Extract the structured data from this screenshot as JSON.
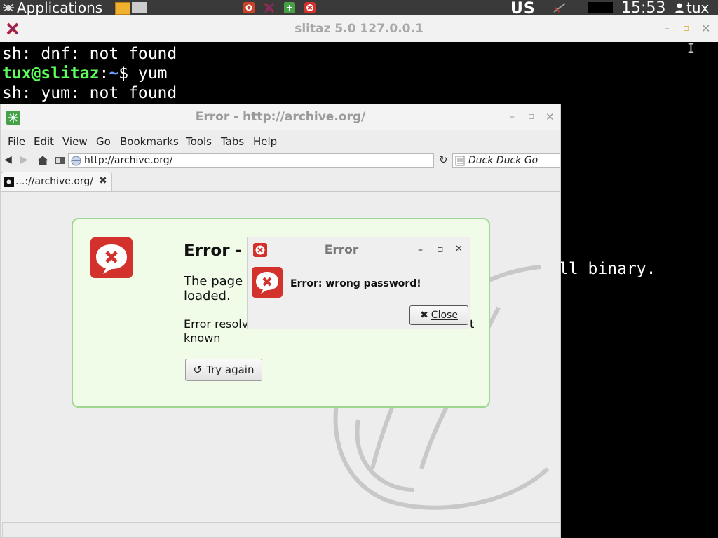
{
  "panel": {
    "applications_label": "Applications",
    "keyboard_layout": "US",
    "clock": "15:53",
    "user": "tux"
  },
  "terminal": {
    "title": "slitaz 5.0 127.0.0.1",
    "lines": [
      {
        "text": "sh: dnf: not found"
      },
      {
        "user": "tux@slitaz",
        "sep": ":",
        "path": "~",
        "cmd": "$ yum"
      },
      {
        "text": "sh: yum: not found"
      }
    ],
    "partial_behind": "ll binary."
  },
  "browser": {
    "title": "Error - http://archive.org/",
    "menu": [
      "File",
      "Edit",
      "View",
      "Go",
      "Bookmarks",
      "Tools",
      "Tabs",
      "Help"
    ],
    "url": "http://archive.org/",
    "search_placeholder": "Duck Duck Go",
    "tab_label": "...://archive.org/",
    "error": {
      "title": "Error -",
      "description_line1": "The page",
      "description_line2": "loaded.",
      "detail_line1": "Error resolv",
      "detail_trailing": "t",
      "detail_line2": "known",
      "try_again_label": "Try again"
    }
  },
  "dialog": {
    "title": "Error",
    "message": "Error: wrong password!",
    "close_label": "Close"
  },
  "colors": {
    "error_red": "#d3322c",
    "prompt_green": "#5cff5c",
    "prompt_blue": "#6c9cff",
    "error_box_bg": "#f0fbe8",
    "error_box_border": "#9ed890"
  }
}
